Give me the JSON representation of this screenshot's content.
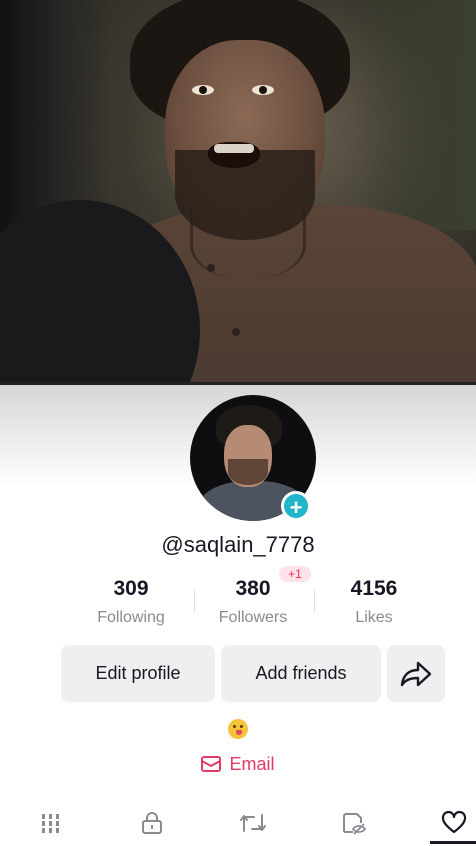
{
  "profile": {
    "username": "@saqlain_7778",
    "stats": {
      "following": {
        "value": "309",
        "label": "Following"
      },
      "followers": {
        "value": "380",
        "label": "Followers",
        "badge": "+1"
      },
      "likes": {
        "value": "4156",
        "label": "Likes"
      }
    },
    "buttons": {
      "edit_profile": "Edit profile",
      "add_friends": "Add friends"
    },
    "bio_emoji": "😋",
    "email_label": "Email"
  },
  "icons": {
    "avatar_add": "plus-icon",
    "share": "share-arrow-icon",
    "email": "envelope-icon",
    "tabs": [
      "grid-icon",
      "lock-icon",
      "repost-icon",
      "hidden-eye-icon",
      "heart-icon"
    ]
  },
  "colors": {
    "accent_pink": "#fe2c55",
    "email_pink": "#e23a62",
    "plus_badge": "#20b5c8",
    "text_primary": "#161823",
    "text_secondary": "#8a8b91",
    "button_bg": "#efefef"
  }
}
